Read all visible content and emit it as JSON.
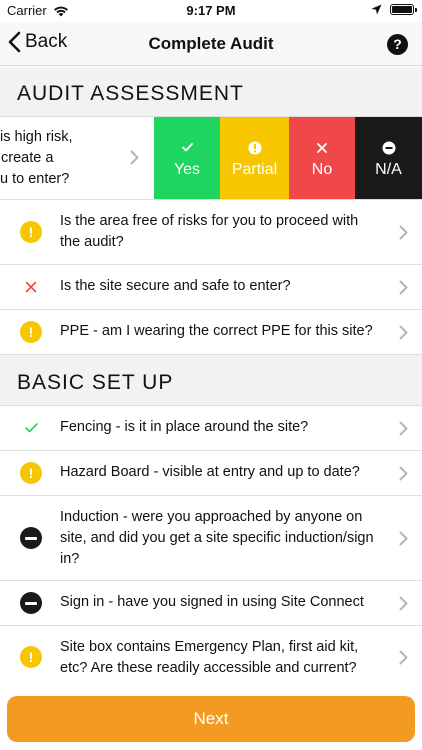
{
  "status_bar": {
    "carrier": "Carrier",
    "time": "9:17 PM"
  },
  "nav": {
    "back_label": "Back",
    "title": "Complete Audit",
    "help_label": "?"
  },
  "sections": {
    "audit_assessment": "AUDIT ASSESSMENT",
    "basic_set_up": "BASIC SET UP"
  },
  "swipe_row": {
    "lines": [
      "is high risk,",
      "create a",
      "u to enter?"
    ],
    "actions": [
      {
        "label": "Yes",
        "color": "#1ed65f",
        "icon": "check-icon"
      },
      {
        "label": "Partial",
        "color": "#f6c700",
        "icon": "exclamation-icon"
      },
      {
        "label": "No",
        "color": "#f04848",
        "icon": "close-icon"
      },
      {
        "label": "N/A",
        "color": "#1a1a1a",
        "icon": "minus-icon"
      }
    ]
  },
  "audit_questions": [
    {
      "status": "partial",
      "text": "Is the area free of risks for you to proceed with the audit?"
    },
    {
      "status": "no",
      "text": "Is the site secure and safe to enter?"
    },
    {
      "status": "partial",
      "text": "PPE - am I wearing the correct PPE for this site?"
    }
  ],
  "setup_questions": [
    {
      "status": "yes",
      "text": "Fencing - is it in place around the site?"
    },
    {
      "status": "partial",
      "text": "Hazard Board - visible at entry and up to date?"
    },
    {
      "status": "na",
      "text": "Induction - were you approached by anyone on site, and did you get a site specific induction/sign in?"
    },
    {
      "status": "na",
      "text": "Sign in - have you signed in using Site Connect"
    },
    {
      "status": "partial",
      "text": "Site box contains Emergency Plan, first aid kit, etc? Are these readily accessible and current?"
    }
  ],
  "next_label": "Next",
  "colors": {
    "accent": "#f39a22",
    "yes": "#1ed65f",
    "partial": "#f6c700",
    "no": "#f04848",
    "na": "#1a1a1a"
  }
}
